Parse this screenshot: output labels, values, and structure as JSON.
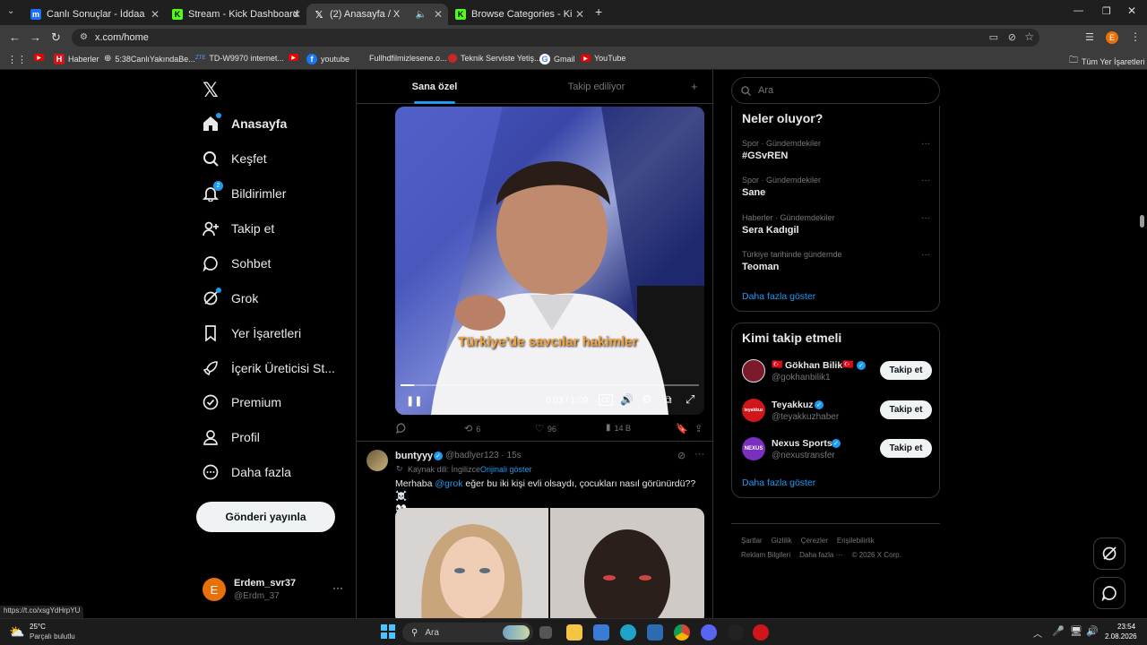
{
  "browser": {
    "tabs": [
      {
        "title": "Canlı Sonuçlar - İddaa Sonuçları",
        "icon": "mackolik-icon",
        "color": "#1e6ff1"
      },
      {
        "title": "Stream - Kick Dashboard",
        "icon": "kick-icon",
        "color": "#53fc18"
      },
      {
        "title": "(2) Anasayfa / X",
        "icon": "x-icon",
        "color": "#ffffff"
      },
      {
        "title": "Browse Categories - Kick Stream",
        "icon": "kick-icon",
        "color": "#53fc18"
      }
    ],
    "url": "x.com/home",
    "profile_initial": "E",
    "bookmarks": [
      "Haberler",
      "5:38CanlıYakındaBe...",
      "TD-W9970 internet...",
      "youtube",
      "Fullhdfilmizlesene.o...",
      "Teknik Serviste Yetiş...",
      "Gmail",
      "YouTube"
    ],
    "all_bookmarks": "Tüm Yer İşaretleri"
  },
  "nav": {
    "items": [
      "Anasayfa",
      "Keşfet",
      "Bildirimler",
      "Takip et",
      "Sohbet",
      "Grok",
      "Yer İşaretleri",
      "İçerik Üreticisi St...",
      "Premium",
      "Profil",
      "Daha fazla"
    ],
    "notif_badge": "2",
    "post_button": "Gönderi yayınla",
    "user_name": "Erdem_svr37",
    "user_handle": "@Erdm_37",
    "user_initial": "E"
  },
  "feed": {
    "tab_for_you": "Sana özel",
    "tab_following": "Takip ediliyor",
    "video": {
      "caption": "Türkiye'de savcılar hakimler",
      "time": "0:03 / 1:09",
      "progress": 0.045
    },
    "actions": {
      "reposts": "6",
      "likes": "96",
      "views": "14 B"
    },
    "post2": {
      "author": "buntyyy",
      "handle": "@badlyer123 · 15s",
      "source_lang": "Kaynak dili: İngilizce",
      "show_original": "Orijinali göster",
      "text_before": "Merhaba ",
      "mention": "@grok",
      "text_after": " eğer bu iki kişi evli olsaydı, çocukları nasıl görünürdü??☠️",
      "emoji_line": "👀"
    }
  },
  "right": {
    "search_placeholder": "Ara",
    "trends_title": "Neler oluyor?",
    "trends": [
      {
        "meta": "Spor · Gündemdekiler",
        "name": "#GSvREN"
      },
      {
        "meta": "Spor · Gündemdekiler",
        "name": "Sane"
      },
      {
        "meta": "Haberler · Gündemdekiler",
        "name": "Sera Kadıgil"
      },
      {
        "meta": "Türkiye tarihinde gündemde",
        "name": "Teoman"
      }
    ],
    "trends_more": "Daha fazla göster",
    "who_title": "Kimi takip etmeli",
    "who": [
      {
        "name": "Gökhan Bilik",
        "handle": "@gokhanbilik1",
        "button": "Takip et",
        "avatar_color": "#7a1a2a"
      },
      {
        "name": "Teyakkuz",
        "handle": "@teyakkuzhaber",
        "button": "Takip et",
        "avatar_color": "#d0161b",
        "avatar_text": "teyakkuz"
      },
      {
        "name": "Nexus Sports",
        "handle": "@nexustransfer",
        "button": "Takip et",
        "avatar_color": "#7b2fbf",
        "avatar_text": "NEXUS"
      }
    ],
    "who_more": "Daha fazla göster",
    "footer_line1": [
      "Şartlar",
      "Gizlilik",
      "Çerezler",
      "Erişilebilirlik"
    ],
    "footer_line2": [
      "Reklam Bilgileri",
      "Daha fazla ···",
      "© 2026 X Corp."
    ]
  },
  "status_url": "https://t.co/xsgYdHrpYU",
  "taskbar": {
    "weather_temp": "25°C",
    "weather_desc": "Parçalı bulutlu",
    "search_label": "Ara",
    "time": "23:54",
    "date": "2.08.2026"
  }
}
